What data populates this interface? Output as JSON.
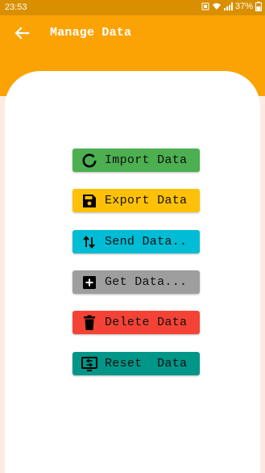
{
  "status_bar": {
    "time": "23:53",
    "battery": "37%"
  },
  "app_bar": {
    "title": "Manage Data",
    "back_icon": "arrow-back-icon"
  },
  "buttons": [
    {
      "label": "Import Data",
      "icon": "loading-circle-icon",
      "color": "#4caf50"
    },
    {
      "label": "Export Data",
      "icon": "save-icon",
      "color": "#ffc107"
    },
    {
      "label": "Send Data..",
      "icon": "swap-vertical-icon",
      "color": "#00bcd4"
    },
    {
      "label": "Get Data...",
      "icon": "add-box-icon",
      "color": "#9e9e9e"
    },
    {
      "label": "Delete Data",
      "icon": "trash-icon",
      "color": "#f44336"
    },
    {
      "label": "Reset  Data",
      "icon": "reset-screen-icon",
      "color": "#009688"
    }
  ],
  "colors": {
    "appbar": "#fba304",
    "statusbar": "#d98f00",
    "background": "#fdebe1",
    "card": "#ffffff"
  }
}
